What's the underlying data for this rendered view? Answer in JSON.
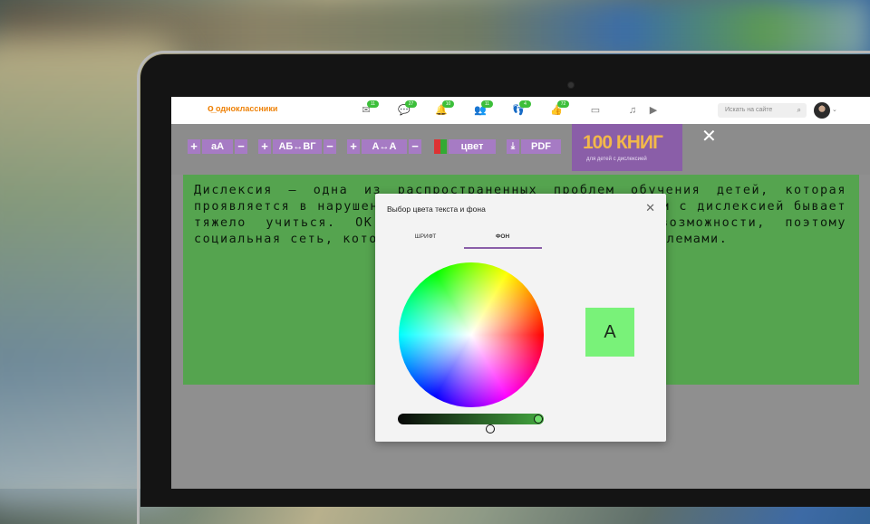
{
  "topbar": {
    "logo_text": "одноклассники",
    "nav": [
      {
        "icon": "mail-icon",
        "badge": "11"
      },
      {
        "icon": "chat-icon",
        "badge": "27"
      },
      {
        "icon": "bell-icon",
        "badge": "10"
      },
      {
        "icon": "friends-icon",
        "badge": "11"
      },
      {
        "icon": "guests-icon",
        "badge": "4"
      },
      {
        "icon": "like-icon",
        "badge": "72"
      },
      {
        "icon": "video-call-icon",
        "badge": ""
      },
      {
        "icon": "music-icon",
        "badge": ""
      },
      {
        "icon": "video-icon",
        "badge": ""
      }
    ],
    "search_placeholder": "Искать на сайте"
  },
  "toolbar": {
    "size_label": "аА",
    "spacing_label": "АБ↔ВГ",
    "letter_spacing_label": "А↔А",
    "color_label": "цвет",
    "pdf_label": "PDF",
    "promo_title": "100 КНИГ",
    "promo_subtitle": "для детей с дислексией"
  },
  "panel": {
    "text": "Дислексия — одна из распространенных проблем обучения детей, которая проявляется в нарушении навыков чтения и письма. Людям с дислексией бывает тяжело учиться. ОК важно предоставлять равные возможности, поэтому социальная сеть, которая сталкивается с подобными проблемами."
  },
  "modal": {
    "title": "Выбор цвета текста и фона",
    "tab_font": "ШРИФТ",
    "tab_background": "ФОН",
    "preview_letter": "А",
    "selected_color": "#79f279",
    "brightness": 1.0
  },
  "colors": {
    "ok_orange": "#ee8208",
    "accent_purple": "#a67bc4",
    "panel_green": "#55a44f"
  }
}
